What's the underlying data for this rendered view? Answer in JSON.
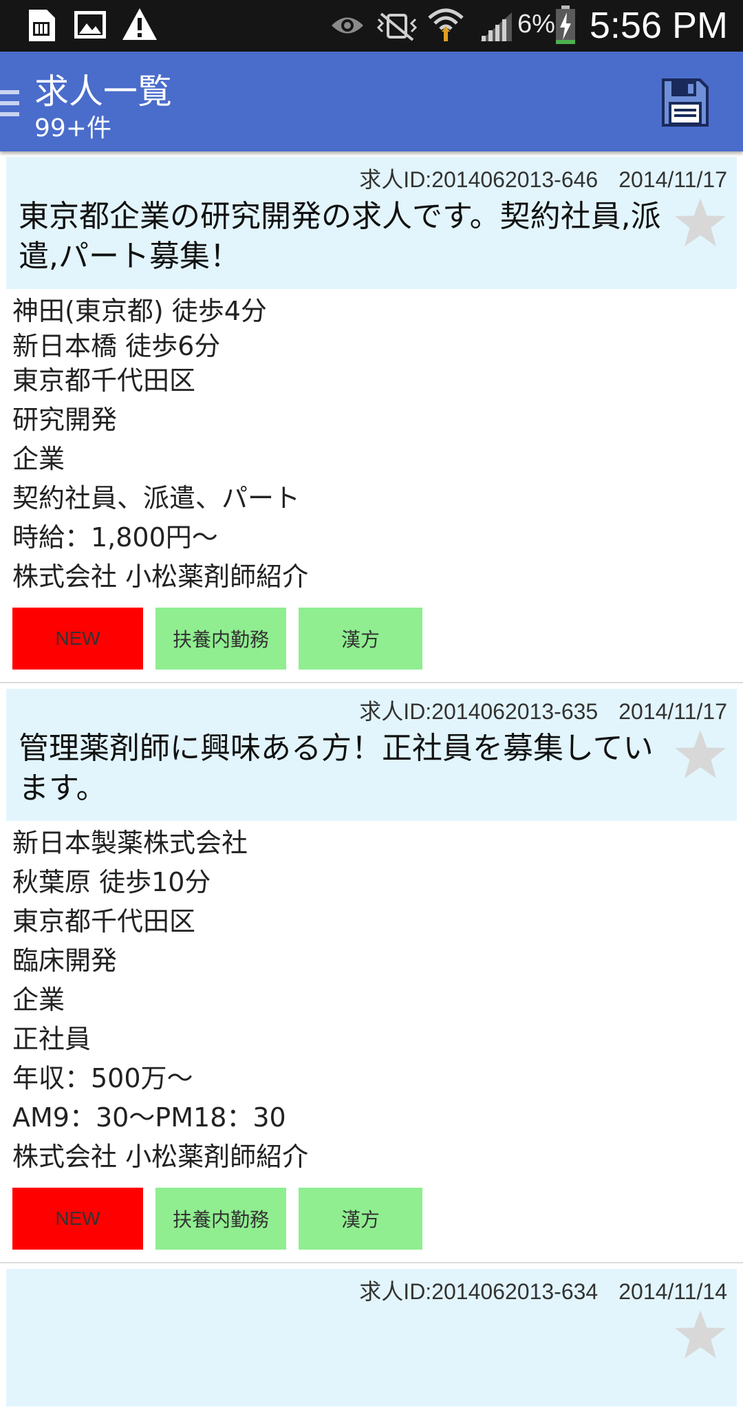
{
  "status_bar": {
    "battery_percent": "6%",
    "time": "5:56 PM",
    "icons": [
      "sim-card-icon",
      "image-icon",
      "warning-icon",
      "eye-icon",
      "vibrate-mute-icon",
      "wifi-icon",
      "signal-icon",
      "battery-charging-icon"
    ]
  },
  "app_bar": {
    "title": "求人一覧",
    "subtitle": "99+件",
    "icons": [
      "drawer-icon",
      "save-icon"
    ]
  },
  "jobs": [
    {
      "id_label": "求人ID:2014062013-646",
      "date": "2014/11/17",
      "title": "東京都企業の研究開発の求人です。契約社員,派遣,パート募集！",
      "lines": [
        "神田(東京都) 徒歩4分",
        "新日本橋 徒歩6分",
        "東京都千代田区",
        "研究開発",
        "企業",
        "契約社員、派遣、パート",
        "時給：1,800円〜",
        "株式会社 小松薬剤師紹介"
      ],
      "tags": [
        "NEW",
        "扶養内勤務",
        "漢方"
      ]
    },
    {
      "id_label": "求人ID:2014062013-635",
      "date": "2014/11/17",
      "title": "管理薬剤師に興味ある方！正社員を募集しています。",
      "lines": [
        "新日本製薬株式会社",
        "秋葉原 徒歩10分",
        "東京都千代田区",
        "臨床開発",
        "企業",
        "正社員",
        "年収：500万〜",
        "AM9：30〜PM18：30",
        "株式会社 小松薬剤師紹介"
      ],
      "tags": [
        "NEW",
        "扶養内勤務",
        "漢方"
      ]
    },
    {
      "id_label": "求人ID:2014062013-634",
      "date": "2014/11/14"
    }
  ],
  "colors": {
    "app_bar": "#4a6ccb",
    "card_header": "#e2f5fc",
    "tag_new": "#ff0000",
    "tag_green": "#90ee90"
  }
}
